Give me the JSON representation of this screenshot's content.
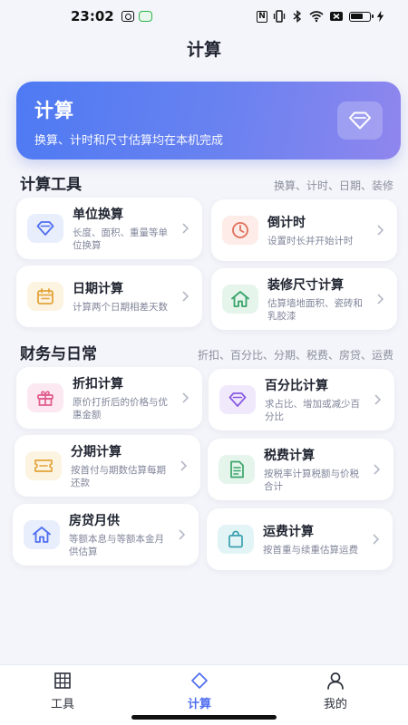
{
  "status_bar": {
    "time": "23:02"
  },
  "header": {
    "title": "计算"
  },
  "banner": {
    "title": "计算",
    "subtitle": "换算、计时和尺寸估算均在本机完成",
    "icon": "diamond-icon"
  },
  "sections": {
    "tools": {
      "title": "计算工具",
      "tags": "换算、计时、日期、装修"
    },
    "finance": {
      "title": "财务与日常",
      "tags": "折扣、百分比、分期、税费、房贷、运费"
    }
  },
  "cards": {
    "unit": {
      "title": "单位换算",
      "desc": "长度、面积、重量等单位换算",
      "icon": "diamond-icon",
      "color": "#4f6ef0",
      "bg": "#e9eefc"
    },
    "countdown": {
      "title": "倒计时",
      "desc": "设置时长并开始计时",
      "icon": "clock-icon",
      "color": "#e0705a",
      "bg": "#fdece8"
    },
    "date": {
      "title": "日期计算",
      "desc": "计算两个日期相差天数",
      "icon": "calendar-icon",
      "color": "#e3a43a",
      "bg": "#fdf3e1"
    },
    "renovation": {
      "title": "装修尺寸计算",
      "desc": "估算墙地面积、瓷砖和乳胶漆",
      "icon": "home-icon",
      "color": "#3aa46a",
      "bg": "#e5f5ec"
    },
    "discount": {
      "title": "折扣计算",
      "desc": "原价打折后的价格与优惠金额",
      "icon": "gift-icon",
      "color": "#e05a8a",
      "bg": "#fce8f0"
    },
    "percent": {
      "title": "百分比计算",
      "desc": "求占比、增加或减少百分比",
      "icon": "diamond-icon",
      "color": "#8a5ae0",
      "bg": "#f0e9fc"
    },
    "installment": {
      "title": "分期计算",
      "desc": "按首付与期数估算每期还款",
      "icon": "ticket-icon",
      "color": "#e3a43a",
      "bg": "#fdf3e1"
    },
    "tax": {
      "title": "税费计算",
      "desc": "按税率计算税额与价税合计",
      "icon": "document-icon",
      "color": "#3aa46a",
      "bg": "#e5f5ec"
    },
    "mortgage": {
      "title": "房贷月供",
      "desc": "等额本息与等额本金月供估算",
      "icon": "home-icon",
      "color": "#4f6ef0",
      "bg": "#e9eefc"
    },
    "shipping": {
      "title": "运费计算",
      "desc": "按首重与续重估算运费",
      "icon": "bag-icon",
      "color": "#3a9fb0",
      "bg": "#e3f4f6"
    }
  },
  "bottom_nav": {
    "tools": "工具",
    "calc": "计算",
    "mine": "我的"
  },
  "accent_color": "#4f6ef0"
}
